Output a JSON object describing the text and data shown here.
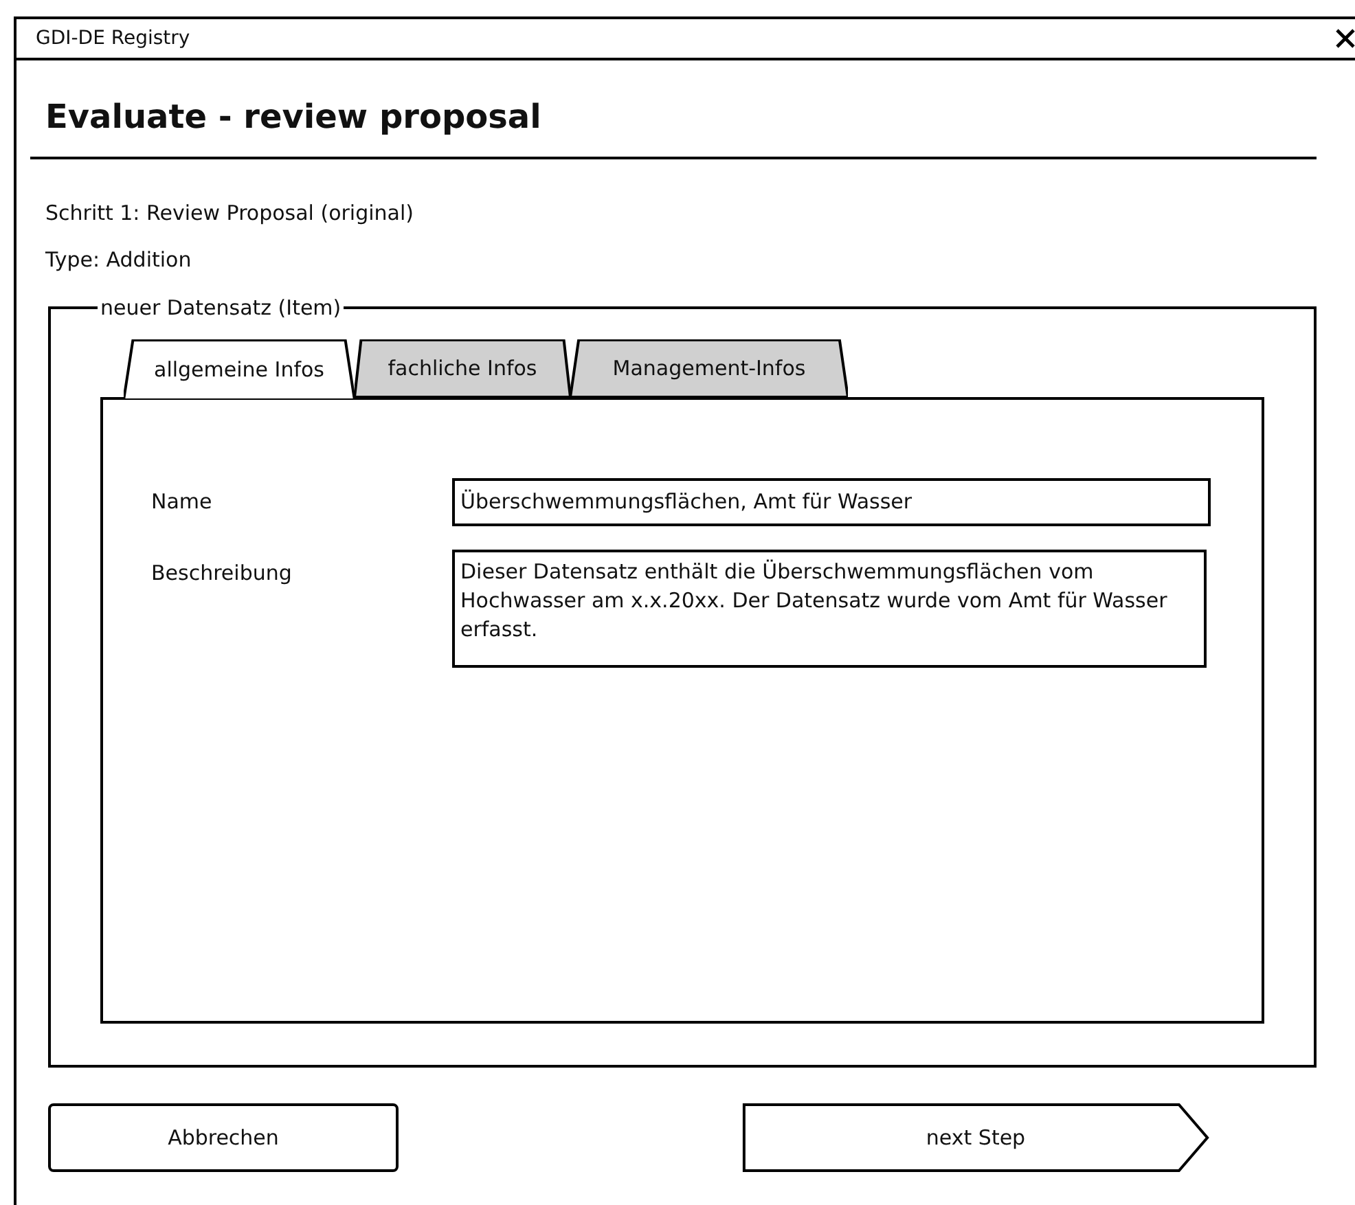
{
  "window": {
    "title": "GDI-DE Registry"
  },
  "heading": "Evaluate - review proposal",
  "step": "Schritt 1: Review Proposal (original)",
  "type": "Type: Addition",
  "group": {
    "legend": "neuer Datensatz (Item)",
    "tabs": [
      {
        "label": "allgemeine Infos",
        "selected": true
      },
      {
        "label": "fachliche Infos",
        "selected": false
      },
      {
        "label": "Management-Infos",
        "selected": false
      }
    ],
    "fields": [
      {
        "label": "Name",
        "value": "Überschwemmungsflächen, Amt für Wasser",
        "kind": "line"
      },
      {
        "label": "Beschreibung",
        "value": "Dieser Datensatz enthält die Überschwemmungsflächen vom Hochwasser am x.x.20xx. Der Datensatz wurde vom Amt für Wasser erfasst.",
        "kind": "area"
      }
    ]
  },
  "buttons": [
    {
      "label": "Abbrechen",
      "kind": "plain"
    },
    {
      "label": "next Step",
      "kind": "forward"
    }
  ]
}
